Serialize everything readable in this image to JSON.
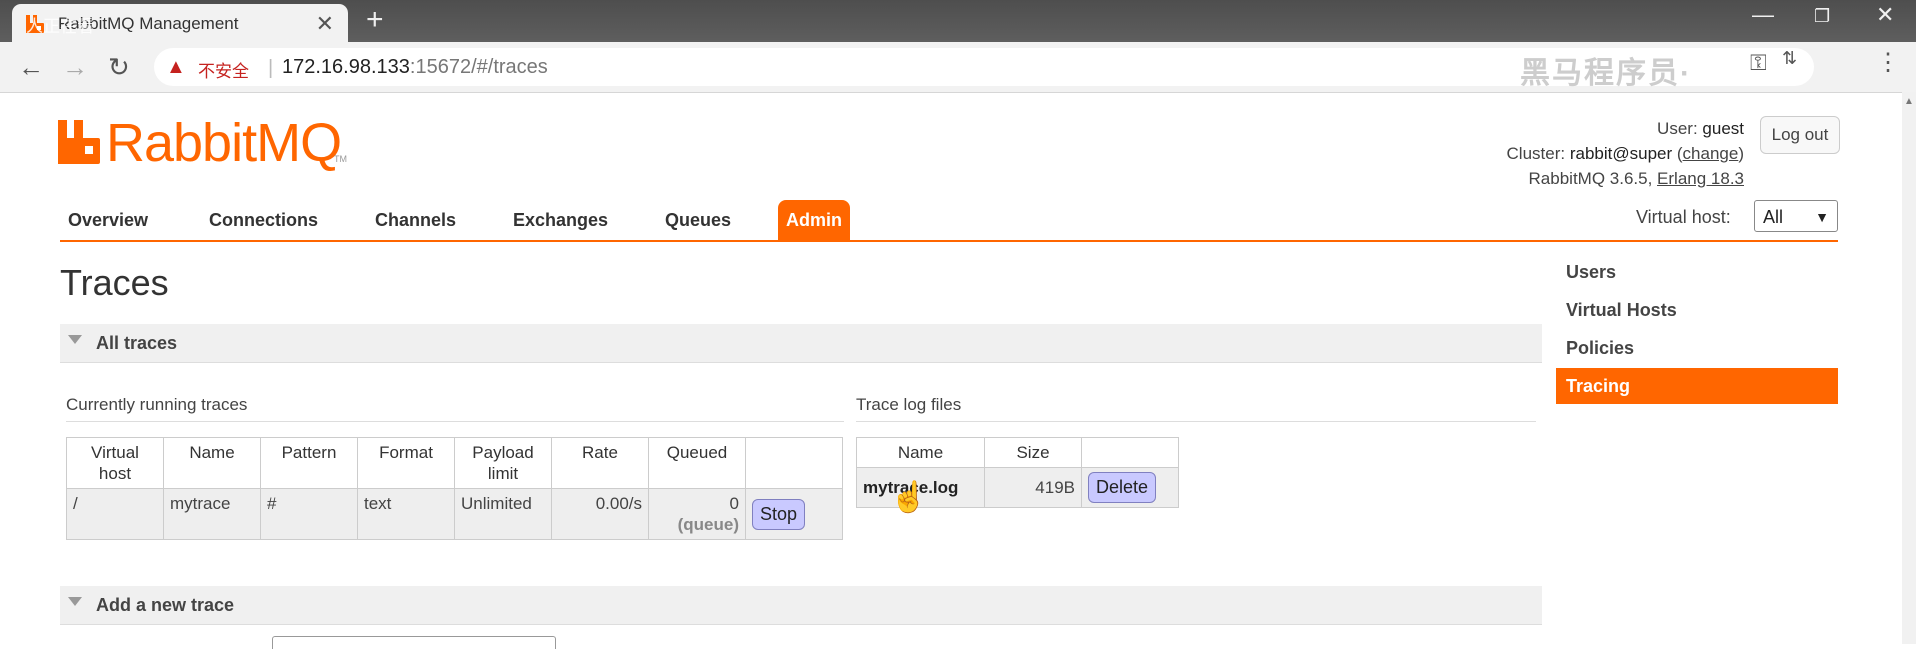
{
  "browser": {
    "tab_title": "RabbitMQ Management",
    "watch_overlay": "人正在看",
    "insecure_label": "不安全",
    "url_host": "172.16.98.133",
    "url_rest": ":15672/#/traces",
    "watermark": "黑马程序员·"
  },
  "header": {
    "logo_text": "RabbitMQ",
    "logo_tm": "TM",
    "user_label": "User:",
    "user_value": "guest",
    "cluster_label": "Cluster:",
    "cluster_value": "rabbit@super",
    "cluster_change": "change",
    "version": "RabbitMQ 3.6.5,",
    "erlang": "Erlang 18.3",
    "logout": "Log out"
  },
  "nav": {
    "items": [
      "Overview",
      "Connections",
      "Channels",
      "Exchanges",
      "Queues",
      "Admin"
    ],
    "vhost_label": "Virtual host:",
    "vhost_value": "All"
  },
  "page": {
    "title": "Traces",
    "all_traces": "All traces",
    "running_label": "Currently running traces",
    "logs_label": "Trace log files",
    "add_trace": "Add a new trace"
  },
  "traces_table": {
    "headers": [
      "Virtual host",
      "Name",
      "Pattern",
      "Format",
      "Payload limit",
      "Rate",
      "Queued"
    ],
    "row": {
      "vhost": "/",
      "name": "mytrace",
      "pattern": "#",
      "format": "text",
      "payload_limit": "Unlimited",
      "rate": "0.00/s",
      "queued": "0",
      "queued_unit": "(queue)",
      "stop": "Stop"
    }
  },
  "logs_table": {
    "headers": [
      "Name",
      "Size"
    ],
    "row": {
      "name": "mytrace.log",
      "size": "419B",
      "delete": "Delete"
    }
  },
  "sidebar": {
    "items": [
      "Users",
      "Virtual Hosts",
      "Policies",
      "Tracing"
    ],
    "active": "Tracing"
  },
  "colors": {
    "accent": "#ff6600",
    "button": "#c9c9ff"
  }
}
